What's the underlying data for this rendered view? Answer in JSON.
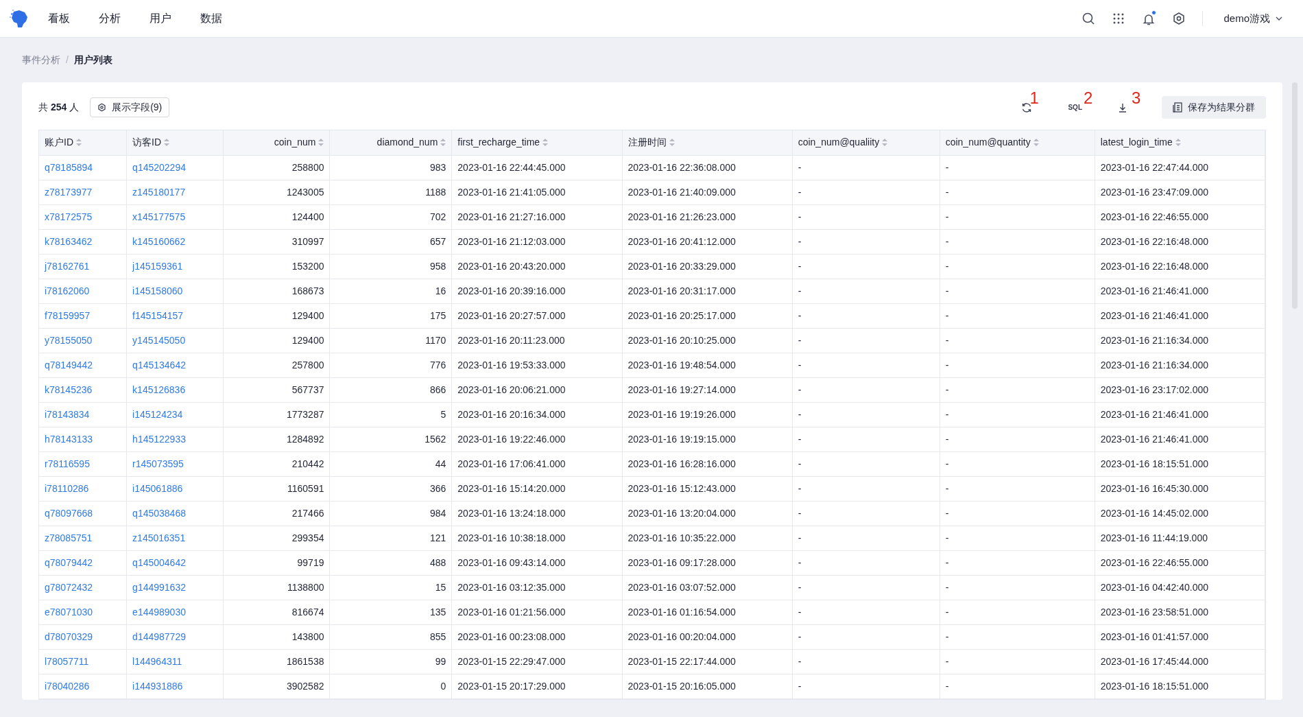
{
  "nav": {
    "items": [
      {
        "label": "看板",
        "selected": false
      },
      {
        "label": "分析",
        "selected": false
      },
      {
        "label": "用户",
        "selected": false
      },
      {
        "label": "数据",
        "selected": false
      }
    ],
    "notification_dot": true,
    "project": "demo游戏"
  },
  "breadcrumb": [
    "事件分析",
    "用户列表"
  ],
  "breadcrumb_separator": "/",
  "summary": {
    "prefix": "共",
    "count": "254",
    "suffix": "人"
  },
  "fields_button": "展示字段(9)",
  "toolbar": {
    "sql": "SQL",
    "save_button": "保存为结果分群",
    "annotations": [
      "1",
      "2",
      "3"
    ]
  },
  "table": {
    "columns": [
      {
        "label": "账户ID",
        "kind": "link"
      },
      {
        "label": "访客ID",
        "kind": "link"
      },
      {
        "label": "coin_num",
        "kind": "number"
      },
      {
        "label": "diamond_num",
        "kind": "number"
      },
      {
        "label": "first_recharge_time",
        "kind": "text"
      },
      {
        "label": "注册时间",
        "kind": "text"
      },
      {
        "label": "coin_num@qualiity",
        "kind": "text"
      },
      {
        "label": "coin_num@quantity",
        "kind": "text"
      },
      {
        "label": "latest_login_time",
        "kind": "text"
      }
    ],
    "rows": [
      [
        "q78185894",
        "q145202294",
        "258800",
        "983",
        "2023-01-16 22:44:45.000",
        "2023-01-16 22:36:08.000",
        "-",
        "-",
        "2023-01-16 22:47:44.000"
      ],
      [
        "z78173977",
        "z145180177",
        "1243005",
        "1188",
        "2023-01-16 21:41:05.000",
        "2023-01-16 21:40:09.000",
        "-",
        "-",
        "2023-01-16 23:47:09.000"
      ],
      [
        "x78172575",
        "x145177575",
        "124400",
        "702",
        "2023-01-16 21:27:16.000",
        "2023-01-16 21:26:23.000",
        "-",
        "-",
        "2023-01-16 22:46:55.000"
      ],
      [
        "k78163462",
        "k145160662",
        "310997",
        "657",
        "2023-01-16 21:12:03.000",
        "2023-01-16 20:41:12.000",
        "-",
        "-",
        "2023-01-16 22:16:48.000"
      ],
      [
        "j78162761",
        "j145159361",
        "153200",
        "958",
        "2023-01-16 20:43:20.000",
        "2023-01-16 20:33:29.000",
        "-",
        "-",
        "2023-01-16 22:16:48.000"
      ],
      [
        "i78162060",
        "i145158060",
        "168673",
        "16",
        "2023-01-16 20:39:16.000",
        "2023-01-16 20:31:17.000",
        "-",
        "-",
        "2023-01-16 21:46:41.000"
      ],
      [
        "f78159957",
        "f145154157",
        "129400",
        "175",
        "2023-01-16 20:27:57.000",
        "2023-01-16 20:25:17.000",
        "-",
        "-",
        "2023-01-16 21:46:41.000"
      ],
      [
        "y78155050",
        "y145145050",
        "129400",
        "1170",
        "2023-01-16 20:11:23.000",
        "2023-01-16 20:10:25.000",
        "-",
        "-",
        "2023-01-16 21:16:34.000"
      ],
      [
        "q78149442",
        "q145134642",
        "257800",
        "776",
        "2023-01-16 19:53:33.000",
        "2023-01-16 19:48:54.000",
        "-",
        "-",
        "2023-01-16 21:16:34.000"
      ],
      [
        "k78145236",
        "k145126836",
        "567737",
        "866",
        "2023-01-16 20:06:21.000",
        "2023-01-16 19:27:14.000",
        "-",
        "-",
        "2023-01-16 23:17:02.000"
      ],
      [
        "i78143834",
        "i145124234",
        "1773287",
        "5",
        "2023-01-16 20:16:34.000",
        "2023-01-16 19:19:26.000",
        "-",
        "-",
        "2023-01-16 21:46:41.000"
      ],
      [
        "h78143133",
        "h145122933",
        "1284892",
        "1562",
        "2023-01-16 19:22:46.000",
        "2023-01-16 19:19:15.000",
        "-",
        "-",
        "2023-01-16 21:46:41.000"
      ],
      [
        "r78116595",
        "r145073595",
        "210442",
        "44",
        "2023-01-16 17:06:41.000",
        "2023-01-16 16:28:16.000",
        "-",
        "-",
        "2023-01-16 18:15:51.000"
      ],
      [
        "i78110286",
        "i145061886",
        "1160591",
        "366",
        "2023-01-16 15:14:20.000",
        "2023-01-16 15:12:43.000",
        "-",
        "-",
        "2023-01-16 16:45:30.000"
      ],
      [
        "q78097668",
        "q145038468",
        "217466",
        "984",
        "2023-01-16 13:24:18.000",
        "2023-01-16 13:20:04.000",
        "-",
        "-",
        "2023-01-16 14:45:02.000"
      ],
      [
        "z78085751",
        "z145016351",
        "299354",
        "121",
        "2023-01-16 10:38:18.000",
        "2023-01-16 10:35:22.000",
        "-",
        "-",
        "2023-01-16 11:44:19.000"
      ],
      [
        "q78079442",
        "q145004642",
        "99719",
        "488",
        "2023-01-16 09:43:14.000",
        "2023-01-16 09:17:28.000",
        "-",
        "-",
        "2023-01-16 22:46:55.000"
      ],
      [
        "g78072432",
        "g144991632",
        "1138800",
        "15",
        "2023-01-16 03:12:35.000",
        "2023-01-16 03:07:52.000",
        "-",
        "-",
        "2023-01-16 04:42:40.000"
      ],
      [
        "e78071030",
        "e144989030",
        "816674",
        "135",
        "2023-01-16 01:21:56.000",
        "2023-01-16 01:16:54.000",
        "-",
        "-",
        "2023-01-16 23:58:51.000"
      ],
      [
        "d78070329",
        "d144987729",
        "143800",
        "855",
        "2023-01-16 00:23:08.000",
        "2023-01-16 00:20:04.000",
        "-",
        "-",
        "2023-01-16 01:41:57.000"
      ],
      [
        "l78057711",
        "l144964311",
        "1861538",
        "99",
        "2023-01-15 22:29:47.000",
        "2023-01-15 22:17:44.000",
        "-",
        "-",
        "2023-01-16 17:45:44.000"
      ],
      [
        "i78040286",
        "i144931886",
        "3902582",
        "0",
        "2023-01-15 20:17:29.000",
        "2023-01-15 20:16:05.000",
        "-",
        "-",
        "2023-01-16 18:15:51.000"
      ]
    ]
  }
}
